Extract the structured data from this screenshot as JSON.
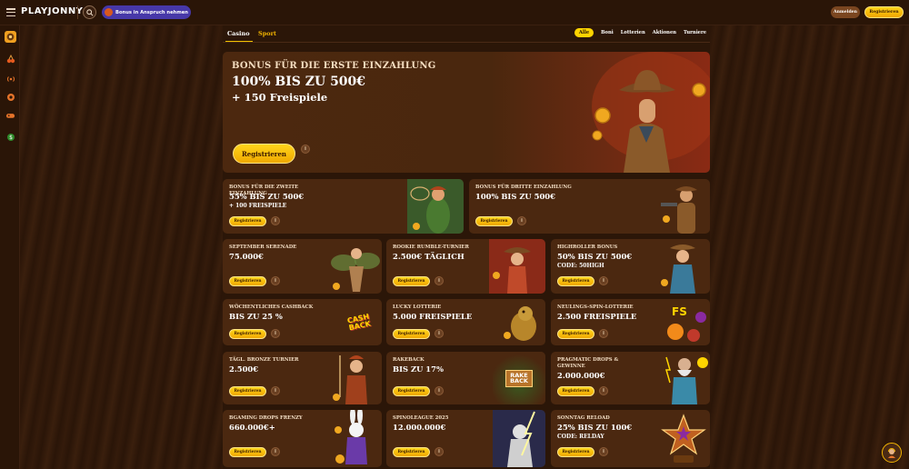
{
  "header": {
    "logo": "PLAYJONNY",
    "bonus_pill": "Bonus in Anspruch nehmen",
    "login_label": "Anmelden",
    "register_label": "Registrieren"
  },
  "sidebar": {
    "items": [
      "casino-icon",
      "fruit-icon",
      "live-icon",
      "sport-ball-icon",
      "gamepad-icon",
      "promo-icon"
    ]
  },
  "tabs": {
    "casino": "Casino",
    "sport": "Sport"
  },
  "filters": [
    "Alle",
    "Boni",
    "Lotterien",
    "Aktionen",
    "Turniere"
  ],
  "hero": {
    "line1": "BONUS FÜR DIE ERSTE EINZAHLUNG",
    "line2": "100% BIS ZU 500€",
    "line3": "+ 150 Freispiele",
    "button": "Registrieren"
  },
  "cards": [
    {
      "title": "Bonus für die zweite Einzahlung",
      "value": "55% bis zu 500€",
      "sub": "+ 100 Freispiele",
      "button": "Registrieren"
    },
    {
      "title": "Bonus für dritte Einzahlung",
      "value": "100% bis zu 500€",
      "sub": "",
      "button": "Registrieren"
    },
    {
      "title": "September Serenade",
      "value": "75.000€",
      "sub": "",
      "button": "Registrieren"
    },
    {
      "title": "Rookie Rumble-Turnier",
      "value": "2.500€ täglich",
      "sub": "",
      "button": "Registrieren"
    },
    {
      "title": "Highroller Bonus",
      "value": "50% bis zu 500€",
      "sub": "Code: 50HIGH",
      "button": "Registrieren"
    },
    {
      "title": "Wöchentliches Cashback",
      "value": "Bis zu 25 %",
      "sub": "",
      "button": "Registrieren"
    },
    {
      "title": "Lucky Lotterie",
      "value": "5.000 Freispiele",
      "sub": "",
      "button": "Registrieren"
    },
    {
      "title": "Neulings-Spin-Lotterie",
      "value": "2.500 Freispiele",
      "sub": "",
      "button": "Registrieren"
    },
    {
      "title": "Tägl. Bronze Turnier",
      "value": "2.500€",
      "sub": "",
      "button": "Registrieren"
    },
    {
      "title": "Rakeback",
      "value": "Bis zu 17%",
      "sub": "",
      "button": "Registrieren"
    },
    {
      "title": "Pragmatic Drops & Gewinne",
      "value": "2.000.000€",
      "sub": "",
      "button": "Registrieren"
    },
    {
      "title": "BGaming Drops Frenzy",
      "value": "660.000€+",
      "sub": "",
      "button": "Registrieren"
    },
    {
      "title": "Spinoleague 2025",
      "value": "12.000.000€",
      "sub": "",
      "button": "Registrieren"
    },
    {
      "title": "Sonntag Reload",
      "value": "25% bis zu 100€",
      "sub": "Code: RELDAY",
      "button": "Registrieren"
    }
  ],
  "art_labels": {
    "cashback": "CASH BACK",
    "rakeback": "RAKE BACK",
    "fs": "FS"
  },
  "colors": {
    "accent": "#ffd400",
    "bg": "#2b1608",
    "card": "#4b2810",
    "bonus_pill": "#4738a8"
  }
}
